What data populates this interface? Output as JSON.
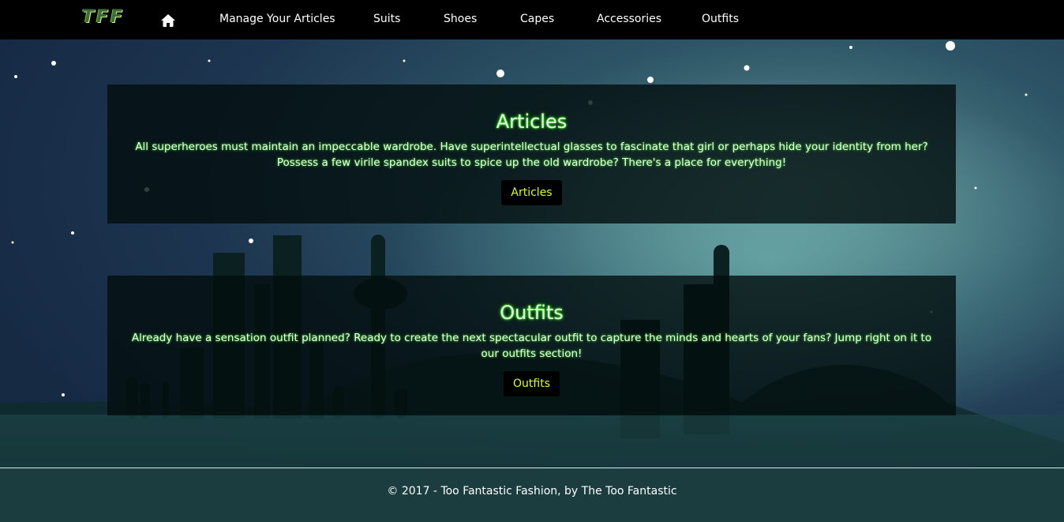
{
  "navbar": {
    "brand": "TFF",
    "home_icon": "home-icon",
    "items": [
      {
        "label": "Manage Your Articles"
      },
      {
        "label": "Suits"
      },
      {
        "label": "Shoes"
      },
      {
        "label": "Capes"
      },
      {
        "label": "Accessories"
      },
      {
        "label": "Outfits"
      }
    ]
  },
  "sections": [
    {
      "title": "Articles",
      "description": "All superheroes must maintain an impeccable wardrobe. Have superintellectual glasses to fascinate that girl or perhaps hide your identity from her? Possess a few virile spandex suits to spice up the old wardrobe? There's a place for everything!",
      "button": "Articles"
    },
    {
      "title": "Outfits",
      "description": "Already have a sensation outfit planned? Ready to create the next spectacular outfit to capture the minds and hearts of your fans? Jump right on it to our outfits section!",
      "button": "Outfits"
    }
  ],
  "footer": {
    "text": "© 2017 - Too Fantastic Fashion, by The Too Fantastic"
  },
  "colors": {
    "navbar_bg": "#000000",
    "button_text": "#d4ff2a",
    "heading_glow": "#39ff14"
  }
}
